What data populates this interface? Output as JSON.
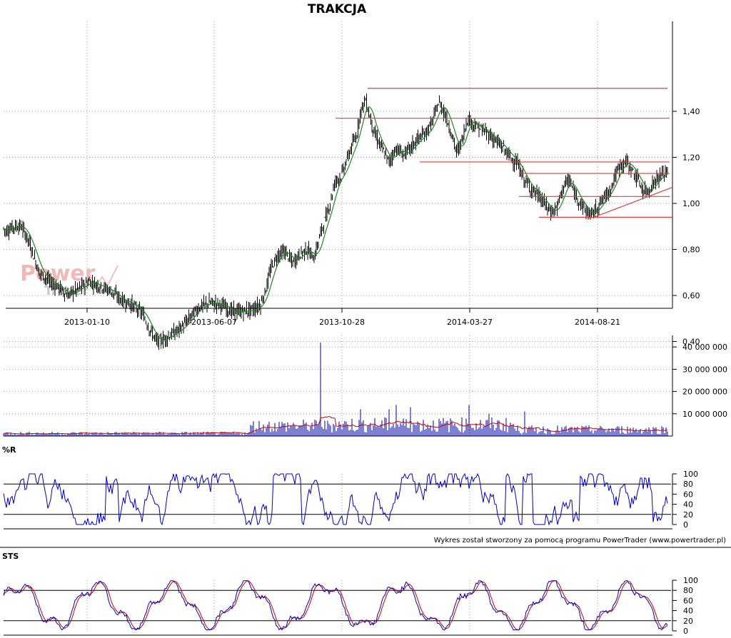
{
  "chart_data": [
    {
      "type": "candlestick",
      "title": "TRAKCJA",
      "x_tick_labels": [
        "2013-01-10",
        "2013-06-07",
        "2013-10-28",
        "2014-03-27",
        "2014-08-21"
      ],
      "y_tick_labels": [
        "0,40",
        "0,60",
        "0,80",
        "1,00",
        "1,20",
        "1,40"
      ],
      "ylim": [
        0.35,
        1.53
      ],
      "grid": true,
      "anchors": [
        [
          0,
          0.91
        ],
        [
          8,
          0.88
        ],
        [
          20,
          0.9
        ],
        [
          30,
          0.9
        ],
        [
          40,
          0.84
        ],
        [
          55,
          0.7
        ],
        [
          70,
          0.66
        ],
        [
          85,
          0.63
        ],
        [
          95,
          0.6
        ],
        [
          110,
          0.63
        ],
        [
          125,
          0.66
        ],
        [
          140,
          0.64
        ],
        [
          155,
          0.62
        ],
        [
          170,
          0.58
        ],
        [
          185,
          0.56
        ],
        [
          200,
          0.52
        ],
        [
          210,
          0.45
        ],
        [
          220,
          0.4
        ],
        [
          230,
          0.41
        ],
        [
          240,
          0.43
        ],
        [
          250,
          0.45
        ],
        [
          260,
          0.48
        ],
        [
          270,
          0.52
        ],
        [
          280,
          0.55
        ],
        [
          295,
          0.57
        ],
        [
          310,
          0.56
        ],
        [
          325,
          0.53
        ],
        [
          340,
          0.53
        ],
        [
          355,
          0.54
        ],
        [
          365,
          0.56
        ],
        [
          372,
          0.62
        ],
        [
          380,
          0.72
        ],
        [
          390,
          0.78
        ],
        [
          400,
          0.79
        ],
        [
          410,
          0.74
        ],
        [
          420,
          0.78
        ],
        [
          430,
          0.8
        ],
        [
          440,
          0.76
        ],
        [
          450,
          0.88
        ],
        [
          460,
          0.97
        ],
        [
          470,
          1.1
        ],
        [
          478,
          1.12
        ],
        [
          485,
          1.18
        ],
        [
          492,
          1.24
        ],
        [
          500,
          1.3
        ],
        [
          505,
          1.4
        ],
        [
          512,
          1.45
        ],
        [
          518,
          1.38
        ],
        [
          525,
          1.3
        ],
        [
          535,
          1.24
        ],
        [
          545,
          1.18
        ],
        [
          555,
          1.24
        ],
        [
          565,
          1.21
        ],
        [
          575,
          1.24
        ],
        [
          585,
          1.28
        ],
        [
          595,
          1.3
        ],
        [
          605,
          1.35
        ],
        [
          615,
          1.44
        ],
        [
          622,
          1.4
        ],
        [
          630,
          1.33
        ],
        [
          640,
          1.22
        ],
        [
          648,
          1.28
        ],
        [
          655,
          1.37
        ],
        [
          665,
          1.34
        ],
        [
          675,
          1.32
        ],
        [
          685,
          1.3
        ],
        [
          695,
          1.27
        ],
        [
          705,
          1.24
        ],
        [
          715,
          1.2
        ],
        [
          725,
          1.17
        ],
        [
          735,
          1.1
        ],
        [
          745,
          1.06
        ],
        [
          755,
          1.03
        ],
        [
          765,
          0.99
        ],
        [
          772,
          0.96
        ],
        [
          780,
          0.98
        ],
        [
          790,
          1.08
        ],
        [
          798,
          1.1
        ],
        [
          805,
          1.04
        ],
        [
          812,
          1.01
        ],
        [
          820,
          0.97
        ],
        [
          828,
          0.95
        ],
        [
          836,
          0.98
        ],
        [
          845,
          1.02
        ],
        [
          855,
          1.06
        ],
        [
          862,
          1.12
        ],
        [
          870,
          1.17
        ],
        [
          878,
          1.18
        ],
        [
          886,
          1.14
        ],
        [
          894,
          1.1
        ],
        [
          902,
          1.05
        ],
        [
          910,
          1.06
        ],
        [
          918,
          1.1
        ],
        [
          926,
          1.12
        ],
        [
          935,
          1.14
        ]
      ],
      "annotations": {
        "horizontal_lines": [
          {
            "y": 1.5,
            "x_from": 515,
            "x_to": 935
          },
          {
            "y": 1.37,
            "x_from": 470,
            "x_to": 938
          },
          {
            "y": 1.18,
            "x_from": 588,
            "x_to": 938
          },
          {
            "y": 1.13,
            "x_from": 727,
            "x_to": 938
          },
          {
            "y": 1.03,
            "x_from": 727,
            "x_to": 938
          },
          {
            "y": 0.94,
            "x_from": 755,
            "x_to": 942
          }
        ],
        "trendline": {
          "from": [
            832,
            0.94
          ],
          "to": [
            942,
            1.07
          ]
        }
      },
      "colors": {
        "candles": "#000000",
        "moving_average": "#1a8a1a",
        "levels": "#e33b3b",
        "grid": "#9a9a9a"
      }
    },
    {
      "type": "bar",
      "series_label": "volume",
      "y_tick_labels": [
        "10 000 000",
        "20 000 000",
        "30 000 000",
        "40 000 000"
      ],
      "ylim": [
        0,
        42000000
      ],
      "spikes": [
        [
          368,
          18000000
        ],
        [
          372,
          11000000
        ],
        [
          380,
          14000000
        ],
        [
          382,
          10000000
        ],
        [
          449,
          42000000
        ],
        [
          452,
          28000000
        ],
        [
          458,
          15000000
        ],
        [
          470,
          13000000
        ],
        [
          480,
          10000000
        ],
        [
          490,
          11000000
        ],
        [
          500,
          13000000
        ],
        [
          505,
          12000000
        ],
        [
          518,
          15000000
        ],
        [
          526,
          14000000
        ],
        [
          545,
          12000000
        ],
        [
          555,
          14000000
        ],
        [
          575,
          13000000
        ],
        [
          610,
          12000000
        ],
        [
          618,
          15000000
        ],
        [
          628,
          11000000
        ],
        [
          657,
          14000000
        ],
        [
          670,
          13000000
        ],
        [
          685,
          10000000
        ],
        [
          710,
          12000000
        ],
        [
          735,
          11000000
        ],
        [
          782,
          9000000
        ],
        [
          868,
          11000000
        ],
        [
          920,
          6000000
        ]
      ],
      "colors": {
        "bars": "#0000a0",
        "moving_average": "#cc0000"
      }
    },
    {
      "type": "line",
      "label": "%R",
      "y_tick_labels": [
        "0",
        "20",
        "40",
        "60",
        "80",
        "100"
      ],
      "ylim": [
        0,
        100
      ],
      "reference_lines": [
        20,
        80
      ],
      "colors": {
        "line": "#0000cc"
      }
    },
    {
      "type": "line",
      "label": "STS",
      "y_tick_labels": [
        "0",
        "20",
        "40",
        "60",
        "80",
        "100"
      ],
      "ylim": [
        0,
        100
      ],
      "reference_lines": [
        20,
        80
      ],
      "colors": {
        "k_line": "#0000cc",
        "d_line": "#cc0000"
      }
    }
  ],
  "watermark": {
    "line1": "Power",
    "line2": "Trader"
  },
  "credit": "Wykres został stworzony za pomocą programu PowerTrader (www.powertrader.pl)"
}
